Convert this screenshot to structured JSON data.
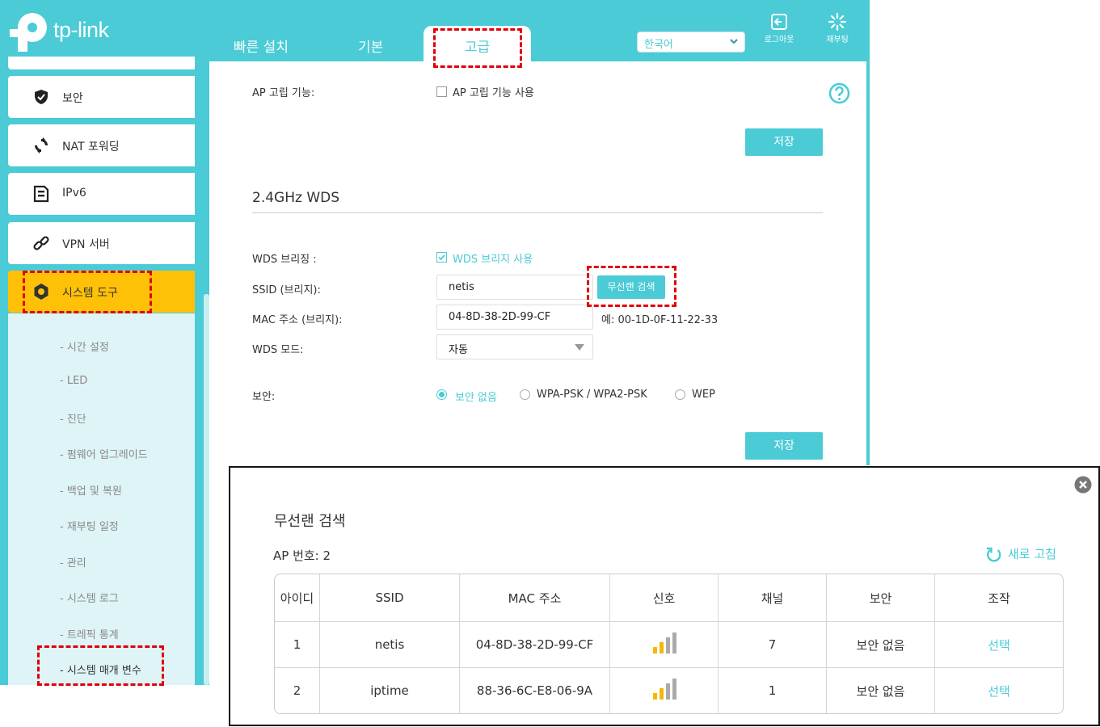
{
  "brand": {
    "logo_text": "tp-link"
  },
  "nav": {
    "tabs": [
      {
        "label": "빠른 설치"
      },
      {
        "label": "기본"
      },
      {
        "label": "고급"
      }
    ]
  },
  "header": {
    "language": "한국어",
    "logout_label": "로그아웃",
    "reboot_label": "재부팅"
  },
  "sidebar": {
    "items": [
      {
        "label": "보안",
        "icon": "shield-icon"
      },
      {
        "label": "NAT 포워딩",
        "icon": "nat-icon"
      },
      {
        "label": "IPv6",
        "icon": "ipv6-icon"
      },
      {
        "label": "VPN 서버",
        "icon": "link-icon"
      },
      {
        "label": "시스템 도구",
        "icon": "gear-icon"
      }
    ],
    "sub_items": [
      "- 시간 설정",
      "- LED",
      "- 진단",
      "- 펌웨어 업그레이드",
      "- 백업 및 복원",
      "- 재부팅 일정",
      "- 관리",
      "- 시스템 로그",
      "- 트레픽 통계",
      "- 시스템 매개 변수"
    ]
  },
  "main": {
    "ap_isolation_label": "AP 고립 기능:",
    "ap_isolation_checkbox": "AP 고립 기능 사용",
    "save_label": "저장",
    "wds_title": "2.4GHz WDS",
    "wds_bridge_label": "WDS 브리징 :",
    "wds_bridge_checkbox": "WDS 브리지 사용",
    "ssid_label": "SSID (브리지):",
    "ssid_value": "netis",
    "survey_button": "무선랜 검색",
    "mac_label": "MAC 주소 (브리지):",
    "mac_value": "04-8D-38-2D-99-CF",
    "mac_example": "예: 00-1D-0F-11-22-33",
    "wds_mode_label": "WDS 모드:",
    "wds_mode_value": "자동",
    "security_label": "보안:",
    "security_options": [
      "보안 없음",
      "WPA-PSK / WPA2-PSK",
      "WEP"
    ],
    "save_label_2": "저장"
  },
  "dialog": {
    "title": "무선랜 검색",
    "ap_count": "AP 번호: 2",
    "refresh_label": "새로 고침",
    "columns": [
      "아이디",
      "SSID",
      "MAC 주소",
      "신호",
      "채널",
      "보안",
      "조작"
    ],
    "rows": [
      {
        "id": "1",
        "ssid": "netis",
        "mac": "04-8D-38-2D-99-CF",
        "signal_bars": 2,
        "channel": "7",
        "security": "보안 없음",
        "action": "선택"
      },
      {
        "id": "2",
        "ssid": "iptime",
        "mac": "88-36-6C-E8-06-9A",
        "signal_bars": 2,
        "channel": "1",
        "security": "보안 없음",
        "action": "선택"
      }
    ]
  },
  "colors": {
    "accent": "#4acbd6",
    "active_menu": "#ffc107",
    "highlight": "#e0000b"
  }
}
